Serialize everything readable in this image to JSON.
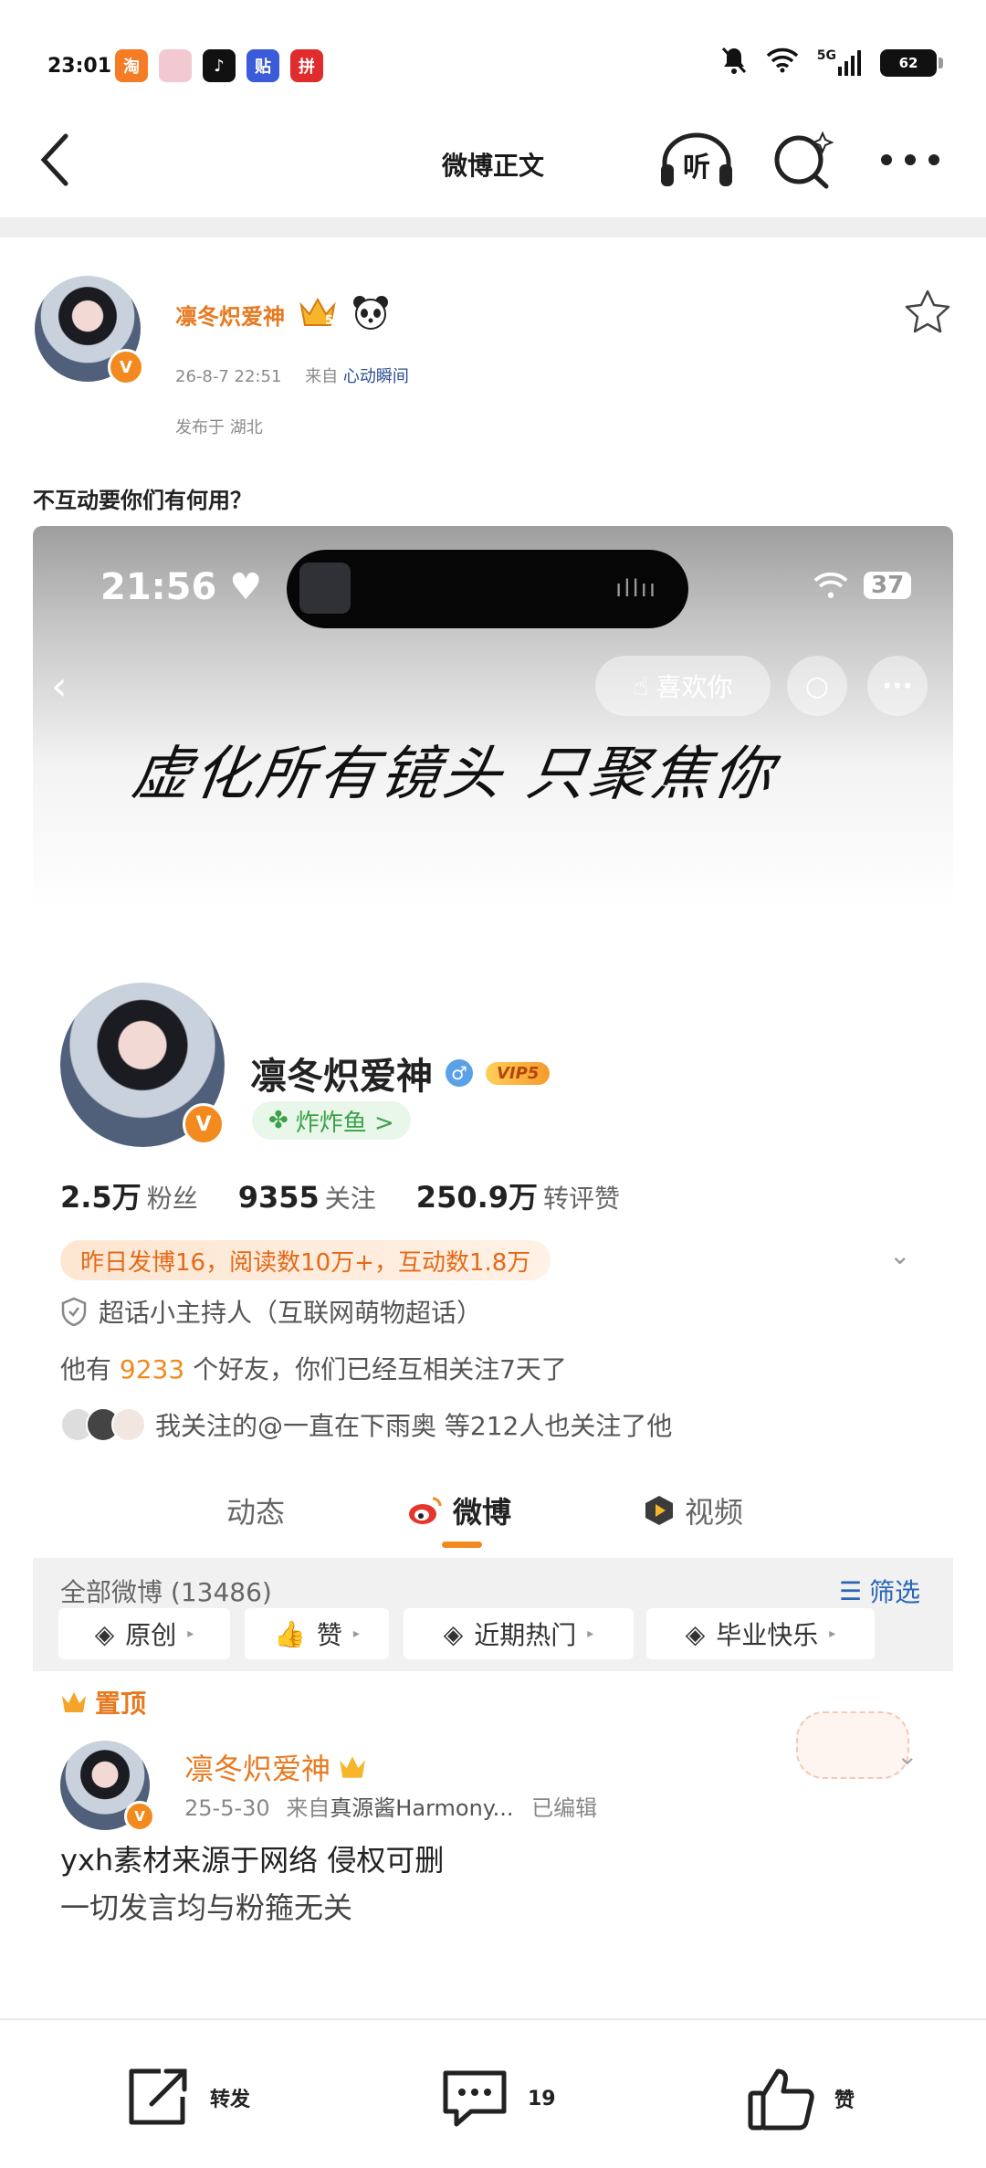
{
  "status_bar": {
    "time": "23:01",
    "signal": "5G",
    "battery": "62",
    "apps": [
      {
        "name": "app-icon-1",
        "bg": "#f57b24",
        "glyph": "淘"
      },
      {
        "name": "app-icon-2",
        "bg": "#f2c9d0",
        "glyph": ""
      },
      {
        "name": "app-icon-tiktok",
        "bg": "#111111",
        "glyph": "♪"
      },
      {
        "name": "app-icon-tieba",
        "bg": "#3b5bd9",
        "glyph": "贴"
      },
      {
        "name": "app-icon-pdd",
        "bg": "#e02c2c",
        "glyph": "拼"
      }
    ]
  },
  "nav": {
    "title": "微博正文",
    "listen_label": "听"
  },
  "post": {
    "author": "凛冬炽爱神",
    "date": "26-8-7 22:51",
    "source_prefix": "来自",
    "source": "心动瞬间",
    "location": "发布于 湖北",
    "text": "不互动要你们有何用？"
  },
  "screenshot": {
    "time": "21:56",
    "battery": "37",
    "like_label": "喜欢你",
    "calligraphy": "虚化所有镜头 只聚焦你",
    "profile": {
      "name": "凛冬炽爱神",
      "vip": "VIP5",
      "tag": "炸炸鱼 >",
      "fans_num": "2.5万",
      "fans_lbl": "粉丝",
      "follow_num": "9355",
      "follow_lbl": "关注",
      "likes_num": "250.9万",
      "likes_lbl": "转评赞",
      "daily": "昨日发博16，阅读数10万+，互动数1.8万",
      "host": "超话小主持人（互联网萌物超话）",
      "friends_prefix": "他有",
      "friends_num": "9233",
      "friends_suffix": "个好友，你们已经互相关注7天了",
      "mutual": "我关注的@一直在下雨奥 等212人也关注了他"
    },
    "tabs": [
      "动态",
      "微博",
      "视频"
    ],
    "all_count": "全部微博 (13486)",
    "filter": "筛选",
    "chips": [
      "原创",
      "赞",
      "近期热门",
      "毕业快乐"
    ],
    "pinned": "置顶",
    "sub_post": {
      "name": "凛冬炽爱神",
      "date": "25-5-30",
      "source_prefix": "来自",
      "source": "真源酱Harmony...",
      "edited": "已编辑",
      "text1": "yxh素材来源于网络 侵权可删",
      "text2": "一切发言均与粉箍无关"
    }
  },
  "bottom_bar": {
    "repost": "转发",
    "comments": "19",
    "like": "赞"
  }
}
